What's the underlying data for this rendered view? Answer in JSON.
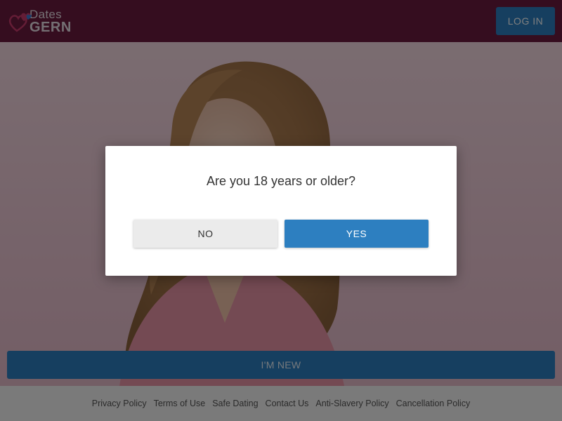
{
  "header": {
    "logo": {
      "top": "Dates",
      "bottom": "GERN",
      "icon": "heart-logo-icon"
    },
    "login_label": "LOG IN"
  },
  "hero": {
    "image": "woman-portrait-photo",
    "cta_label": "I'M NEW"
  },
  "footer": {
    "links": [
      "Privacy Policy",
      "Terms of Use",
      "Safe Dating",
      "Contact Us",
      "Anti-Slavery Policy",
      "Cancellation Policy"
    ]
  },
  "modal": {
    "question": "Are you 18 years or older?",
    "no_label": "NO",
    "yes_label": "YES"
  },
  "colors": {
    "brand": "#6b1a3f",
    "accent": "#2d7fc0",
    "hero_bg": "#eec9d6"
  }
}
